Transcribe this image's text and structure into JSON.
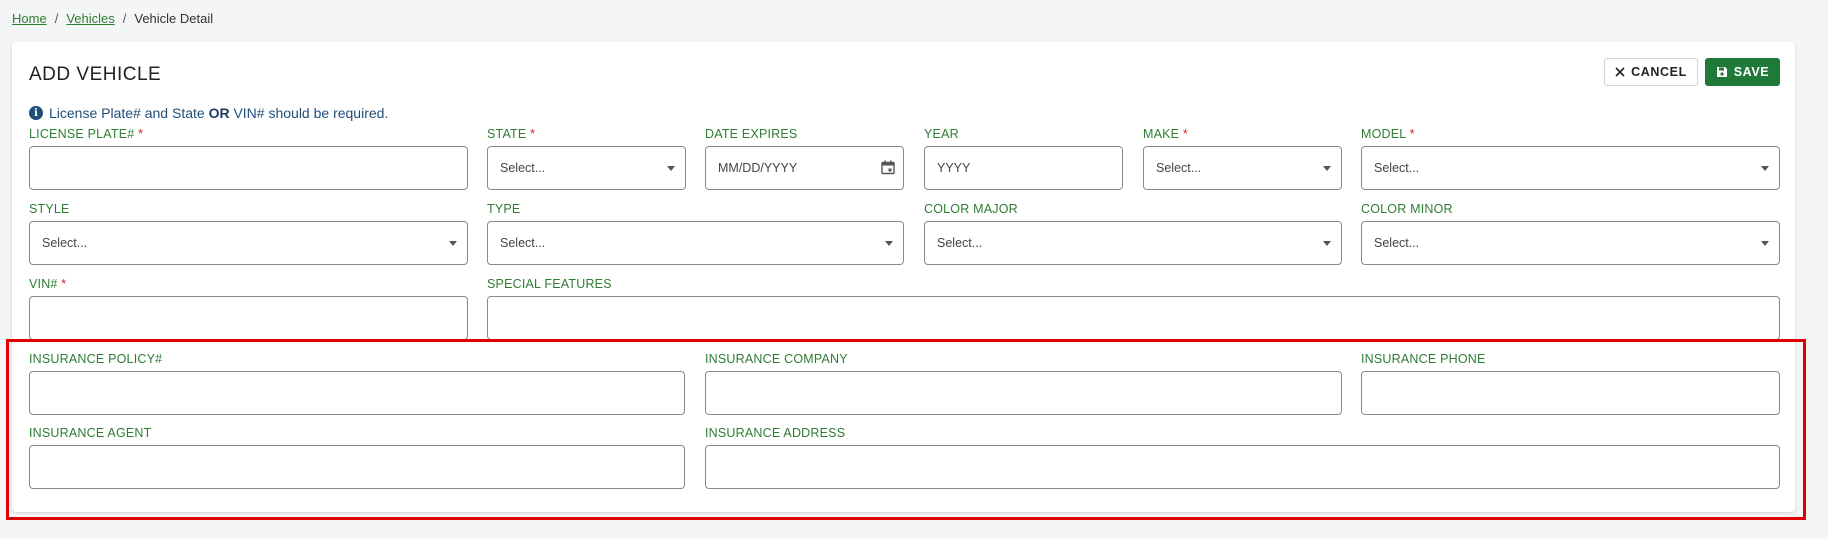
{
  "breadcrumb": {
    "home": "Home",
    "sep1": "/",
    "vehicles": "Vehicles",
    "sep2": "/",
    "current": "Vehicle Detail"
  },
  "header": {
    "title": "ADD VEHICLE",
    "cancel_label": "CANCEL",
    "save_label": "SAVE"
  },
  "info": {
    "part1": "License Plate# and State ",
    "bold": "OR",
    "part2": " VIN# should be required."
  },
  "fields": {
    "license_plate": {
      "label": "LICENSE PLATE#",
      "required": "*",
      "value": ""
    },
    "state": {
      "label": "STATE",
      "required": "*",
      "placeholder": "Select..."
    },
    "date_expires": {
      "label": "DATE EXPIRES",
      "placeholder": "MM/DD/YYYY"
    },
    "year": {
      "label": "YEAR",
      "placeholder": "YYYY"
    },
    "make": {
      "label": "MAKE",
      "required": "*",
      "placeholder": "Select..."
    },
    "model": {
      "label": "MODEL",
      "required": "*",
      "placeholder": "Select..."
    },
    "style": {
      "label": "STYLE",
      "placeholder": "Select..."
    },
    "type": {
      "label": "TYPE",
      "placeholder": "Select..."
    },
    "color_major": {
      "label": "COLOR MAJOR",
      "placeholder": "Select..."
    },
    "color_minor": {
      "label": "COLOR MINOR",
      "placeholder": "Select..."
    },
    "vin": {
      "label": "VIN#",
      "required": "*",
      "value": ""
    },
    "special_features": {
      "label": "SPECIAL FEATURES",
      "value": ""
    },
    "insurance_policy": {
      "label": "INSURANCE POLICY#",
      "value": ""
    },
    "insurance_company": {
      "label": "INSURANCE COMPANY",
      "value": ""
    },
    "insurance_phone": {
      "label": "INSURANCE PHONE",
      "value": ""
    },
    "insurance_agent": {
      "label": "INSURANCE AGENT",
      "value": ""
    },
    "insurance_address": {
      "label": "INSURANCE ADDRESS",
      "value": ""
    }
  },
  "icons": {
    "info": "info-circle-icon",
    "cancel": "close-icon",
    "save": "save-icon",
    "calendar": "calendar-icon",
    "dropdown": "chevron-down-icon"
  },
  "colors": {
    "accent": "#1f7a39",
    "label": "#2e7d32",
    "info": "#1f4e79",
    "highlight": "#e00000"
  }
}
